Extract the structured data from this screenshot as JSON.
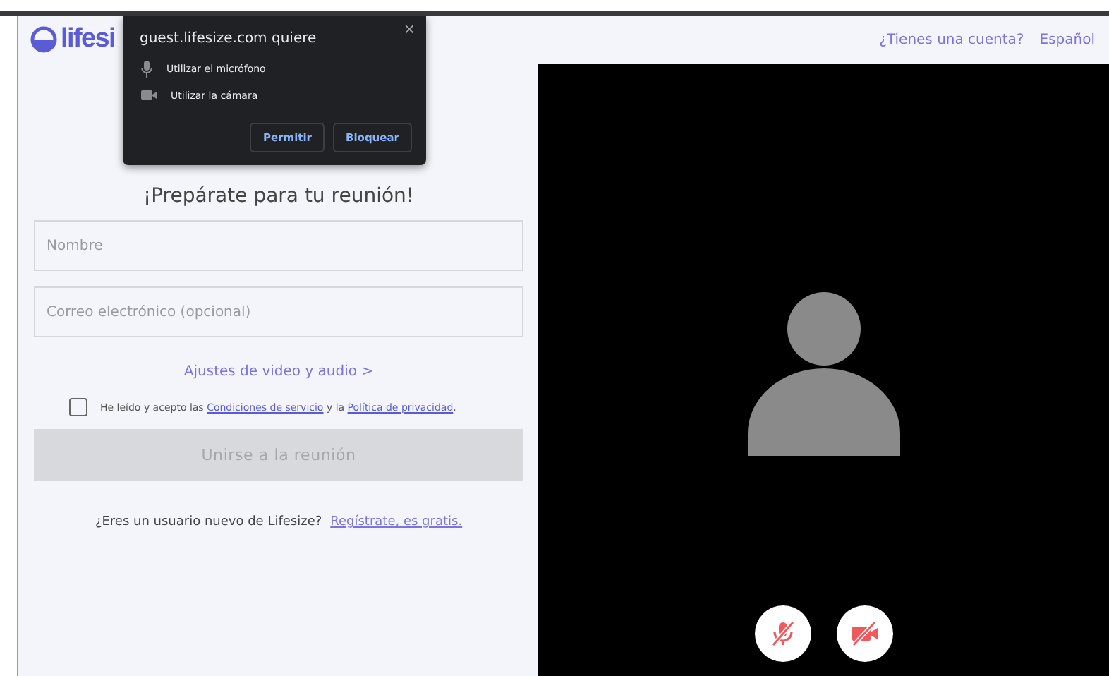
{
  "header": {
    "logo": "lifesi",
    "account_link": "¿Tienes una cuenta?",
    "language": "Español"
  },
  "permission_popup": {
    "title": "guest.lifesize.com quiere",
    "items": [
      {
        "kind": "mic",
        "label": "Utilizar el micrófono"
      },
      {
        "kind": "camera",
        "label": "Utilizar la cámara"
      }
    ],
    "buttons": [
      "Permitir",
      "Bloquear"
    ],
    "close": "×"
  },
  "form": {
    "heading": "¡Prepárate para tu reunión!",
    "name_placeholder": "Nombre",
    "email_placeholder": "Correo electrónico (opcional)",
    "settings_link": "Ajustes de video y audio >",
    "consent": {
      "checked": false,
      "text_before": "He leído y acepto las",
      "terms_link": "Condiciones de servicio",
      "text_middle": "y la",
      "privacy_link": "Política de privacidad",
      "text_after": "."
    },
    "join_button": {
      "label": "Unirse a la reunión",
      "disabled": true
    },
    "signup_text": "¿Eres un usuario nuevo de Lifesize?",
    "signup_link": "Regístrate, es gratis."
  },
  "video": {
    "controls": [
      {
        "kind": "mic",
        "muted": true
      },
      {
        "kind": "camera",
        "muted": true
      }
    ]
  }
}
